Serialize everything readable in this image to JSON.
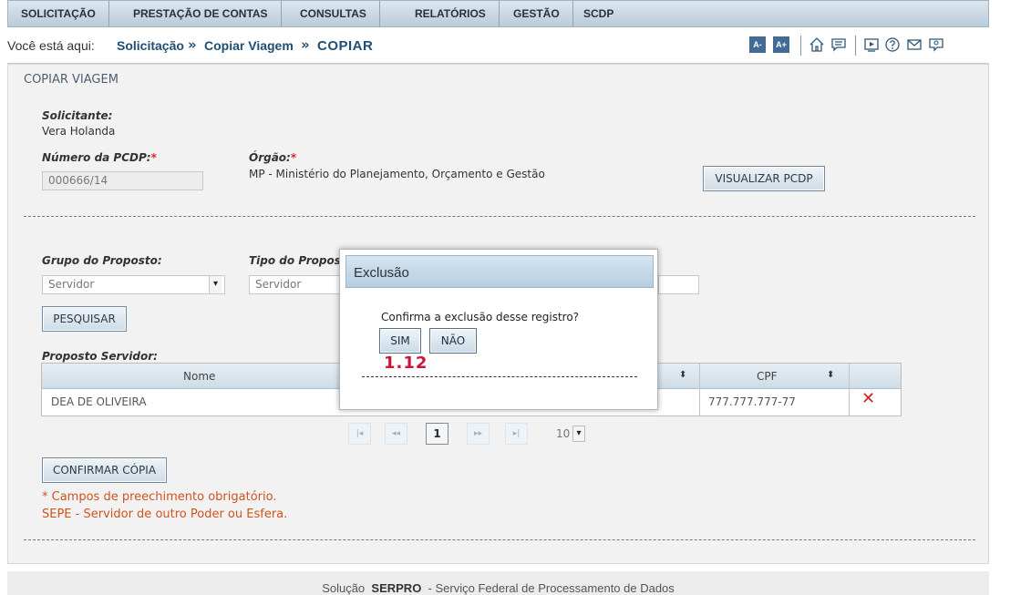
{
  "menu": [
    "SOLICITAÇÃO",
    "PRESTAÇÃO DE CONTAS",
    "CONSULTAS",
    "RELATÓRIOS",
    "GESTÃO",
    "SCDP"
  ],
  "breadcrumb": {
    "label": "Você está aqui:",
    "items": [
      "Solicitação",
      "Copiar Viagem",
      "COPIAR"
    ],
    "separator": "»",
    "font_smaller": "A-",
    "font_larger": "A+"
  },
  "page": {
    "section_title": "COPIAR VIAGEM",
    "solicitante_label": "Solicitante:",
    "solicitante_value": "Vera Holanda",
    "pcdp_label": "Número da PCDP:",
    "pcdp_value": "000666/14",
    "orgao_label": "Órgão:",
    "orgao_value": "MP - Ministério do Planejamento, Orçamento e Gestão",
    "required_mark": "*",
    "visualizar_button": "VISUALIZAR PCDP",
    "grupo_label": "Grupo do Proposto:",
    "grupo_value": "Servidor",
    "tipo_label": "Tipo do Propos",
    "tipo_value": "Servidor",
    "pesquisar_button": "PESQUISAR",
    "proposto_label": "Proposto Servidor:"
  },
  "table": {
    "columns": [
      "Nome",
      "CPF"
    ],
    "rows": [
      {
        "nome": "DEA DE OLIVEIRA",
        "cpf": "777.777.777-77"
      }
    ],
    "sort_glyph": "⬍",
    "delete_glyph": "✕"
  },
  "pagination": {
    "first": "|◂",
    "prev": "◂◂",
    "current": "1",
    "next": "▸▸",
    "last": "▸|",
    "page_size": "10"
  },
  "confirm_button": "CONFIRMAR CÓPIA",
  "notes": [
    "* Campos de preechimento obrigatório.",
    "SEPE - Servidor de outro Poder ou Esfera."
  ],
  "footer": {
    "prefix": "Solução",
    "brand": "SERPRO",
    "suffix": "- Serviço Federal de Processamento de Dados"
  },
  "modal": {
    "title": "Exclusão",
    "message": "Confirma a exclusão desse registro?",
    "yes": "SIM",
    "no": "NÃO",
    "annotation": "1.12"
  }
}
